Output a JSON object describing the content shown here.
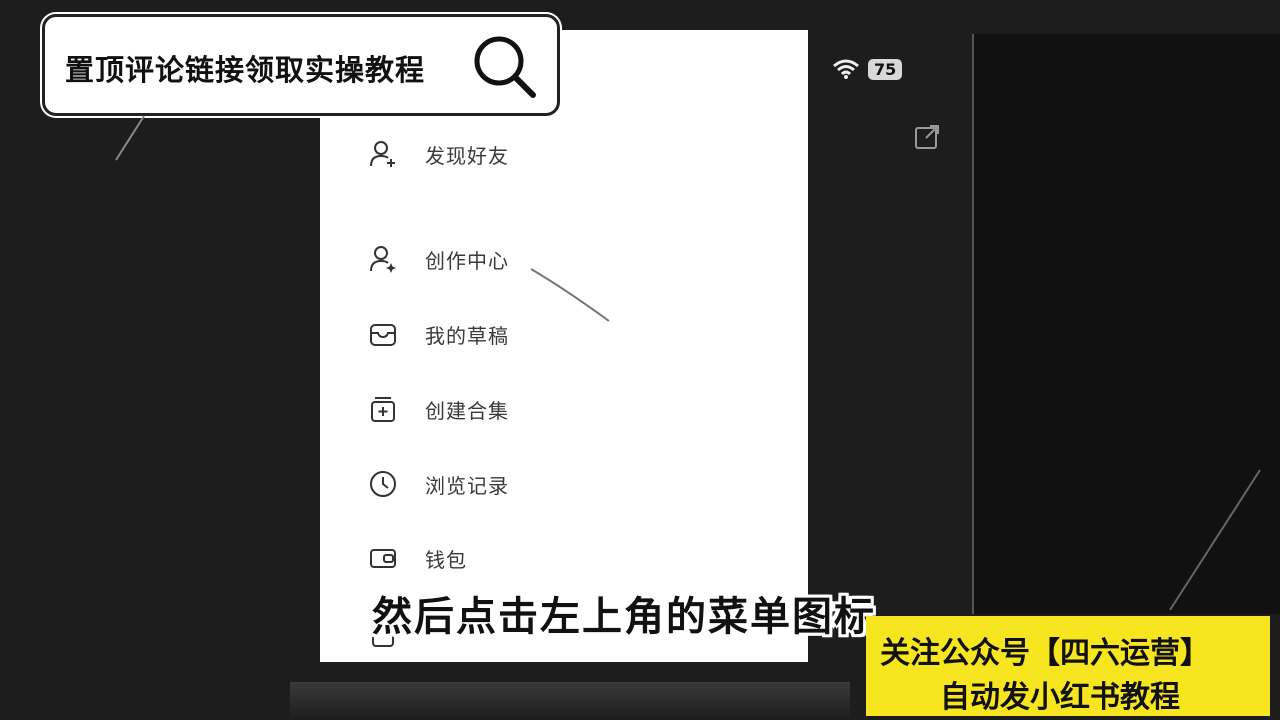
{
  "search_callout": {
    "text": "置顶评论链接领取实操教程",
    "icon": "magnifier-icon"
  },
  "status_bar": {
    "battery": "75",
    "wifi_icon": "wifi-icon"
  },
  "menu": {
    "items": [
      {
        "label": "发现好友",
        "icon": "add-friend-icon"
      },
      {
        "label": "创作中心",
        "icon": "creator-icon"
      },
      {
        "label": "我的草稿",
        "icon": "drafts-icon"
      },
      {
        "label": "创建合集",
        "icon": "collection-icon"
      },
      {
        "label": "浏览记录",
        "icon": "history-clock-icon"
      },
      {
        "label": "钱包",
        "icon": "wallet-icon"
      }
    ]
  },
  "subtitle": "然后点击左上角的菜单图标",
  "banner": {
    "line1": "关注公众号【四六运营】",
    "line2": "自动发小红书教程"
  },
  "colors": {
    "banner_bg": "#f6e51f",
    "panel_bg": "#ffffff",
    "background": "#1d1d1d"
  }
}
